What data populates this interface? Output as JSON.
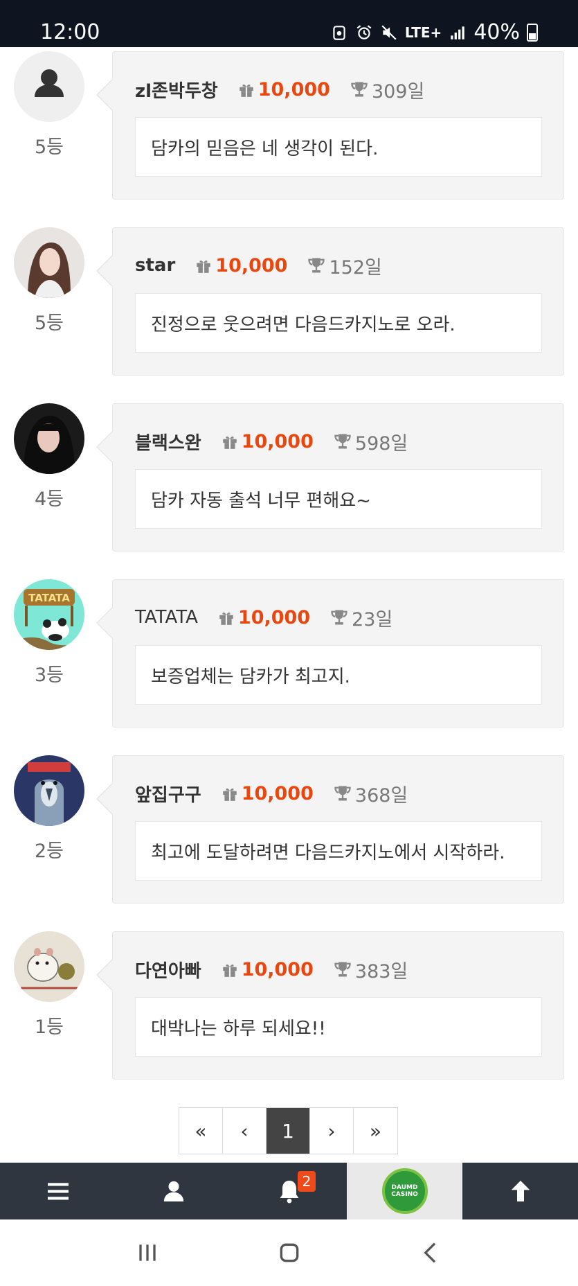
{
  "status_bar": {
    "time": "12:00",
    "network": "LTE+",
    "battery": "40%",
    "icons": [
      "data-saver-icon",
      "alarm-icon",
      "mute-icon",
      "lte-icon",
      "signal-icon",
      "battery-icon"
    ]
  },
  "comments": [
    {
      "nickname": "zl존박두창",
      "points": "10,000",
      "days": "309일",
      "rank": "5등",
      "message": "담카의 믿음은 네 생각이 된다.",
      "avatar": "default-user-icon"
    },
    {
      "nickname": "star",
      "points": "10,000",
      "days": "152일",
      "rank": "5등",
      "message": "진정으로 웃으려면 다음드카지노로 오라.",
      "avatar": "photo-woman-light"
    },
    {
      "nickname": "블랙스완",
      "points": "10,000",
      "days": "598일",
      "rank": "4등",
      "message": "담카 자동 출석 너무 편해요~",
      "avatar": "photo-woman-dark"
    },
    {
      "nickname": "TATATA",
      "points": "10,000",
      "days": "23일",
      "rank": "3등",
      "message": "보증업체는 담카가 최고지.",
      "avatar": "tatata-panda"
    },
    {
      "nickname": "앞집구구",
      "points": "10,000",
      "days": "368일",
      "rank": "2등",
      "message": "최고에 도달하려면 다음드카지노에서 시작하라.",
      "avatar": "cartoon-bird"
    },
    {
      "nickname": "다연아빠",
      "points": "10,000",
      "days": "383일",
      "rank": "1등",
      "message": "대박나는 하루 되세요!!",
      "avatar": "cartoon-hamster"
    }
  ],
  "pagination": {
    "first": "«",
    "prev": "‹",
    "current": "1",
    "next": "›",
    "last": "»"
  },
  "bottom_nav": {
    "items": [
      "menu-icon",
      "user-icon",
      "bell-icon",
      "site-logo",
      "arrow-up-icon"
    ],
    "notification_count": "2",
    "logo_text_top": "DAUMD",
    "logo_text_bottom": "CASINO"
  },
  "system_nav": {
    "items": [
      "recents-icon",
      "home-icon",
      "back-icon"
    ]
  },
  "colors": {
    "accent": "#e8480f",
    "nav_bg": "#2f3640",
    "status_bg": "#0f1520",
    "badge": "#ee4a1a"
  }
}
